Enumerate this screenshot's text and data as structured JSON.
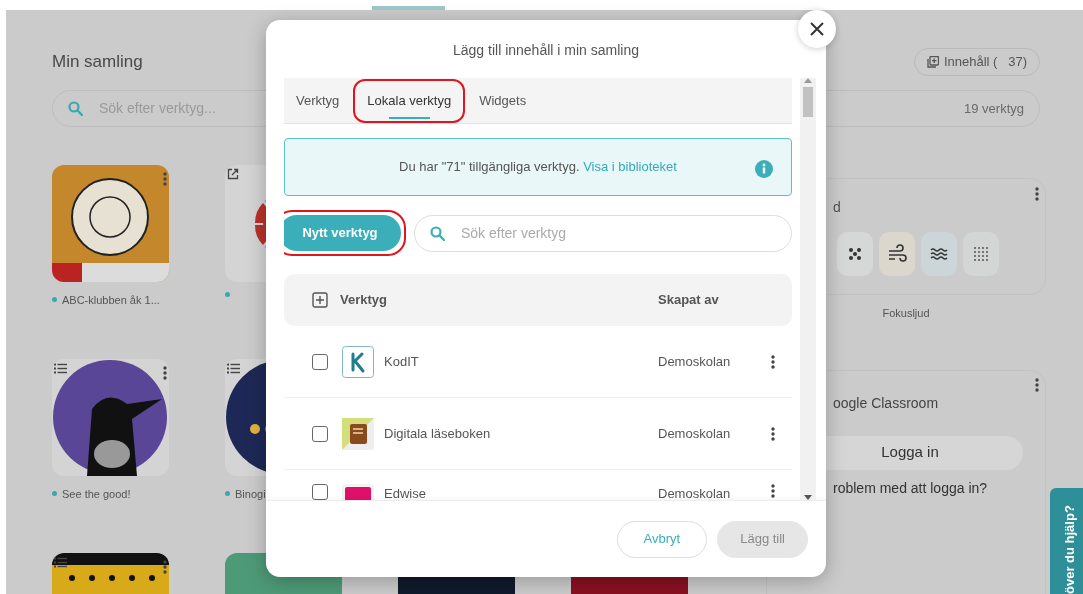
{
  "page": {
    "title": "Min samling",
    "content_button": "Innehåll (   37)",
    "search": {
      "placeholder": "Sök efter verktyg...",
      "count": "19 verktyg"
    },
    "tile_rows": [
      [
        {
          "kind": "abc",
          "menu": true,
          "dot": true,
          "label": "ABC-klubben åk 1..."
        },
        {
          "kind": "sun",
          "external": true,
          "dot": true
        }
      ],
      [
        {
          "kind": "bird",
          "list": true,
          "menu": true,
          "dot": true,
          "label": "See the good!"
        },
        {
          "kind": "binogi",
          "list": true,
          "dot": true,
          "label": "Binogi"
        }
      ],
      [
        {
          "kind": "pattern",
          "list": true,
          "menu": true
        },
        {
          "kind": "green"
        },
        {
          "kind": "navy"
        },
        {
          "kind": "red"
        }
      ]
    ],
    "widget": {
      "title": "d",
      "sounds": [
        {
          "kind": "dots"
        },
        {
          "kind": "wind"
        },
        {
          "kind": "waves"
        },
        {
          "kind": "grid"
        }
      ],
      "label": "Fokusljud"
    },
    "classroom": {
      "title": "oogle Classroom",
      "button": "Logga in",
      "link": "roblem med att logga in?"
    },
    "help_tab": "över du hjälp?"
  },
  "dialog": {
    "title": "Lägg till innehåll i min samling",
    "tabs": [
      {
        "label": "Verktyg",
        "selected": false,
        "annotated": false
      },
      {
        "label": "Lokala verktyg",
        "selected": true,
        "annotated": true
      },
      {
        "label": "Widgets",
        "selected": false,
        "annotated": false
      }
    ],
    "notice": {
      "text": "Du har \"71\" tillgängliga verktyg.",
      "link": "Visa i biblioteket"
    },
    "new_button": {
      "label": "Nytt verktyg",
      "annotated": true
    },
    "search": {
      "placeholder": "Sök efter verktyg"
    },
    "table": {
      "columns": [
        "Verktyg",
        "Skapat av"
      ],
      "rows": [
        {
          "name": "KodIT",
          "creator": "Demoskolan",
          "checked": false,
          "kind": "kodit"
        },
        {
          "name": "Digitala läseboken",
          "creator": "Demoskolan",
          "checked": false,
          "kind": "book"
        },
        {
          "name": "Edwise",
          "creator": "Demoskolan",
          "checked": false,
          "kind": "edwise"
        }
      ]
    },
    "buttons": [
      {
        "label": "Avbryt",
        "disabled": false
      },
      {
        "label": "Lägg till",
        "disabled": true
      }
    ]
  }
}
